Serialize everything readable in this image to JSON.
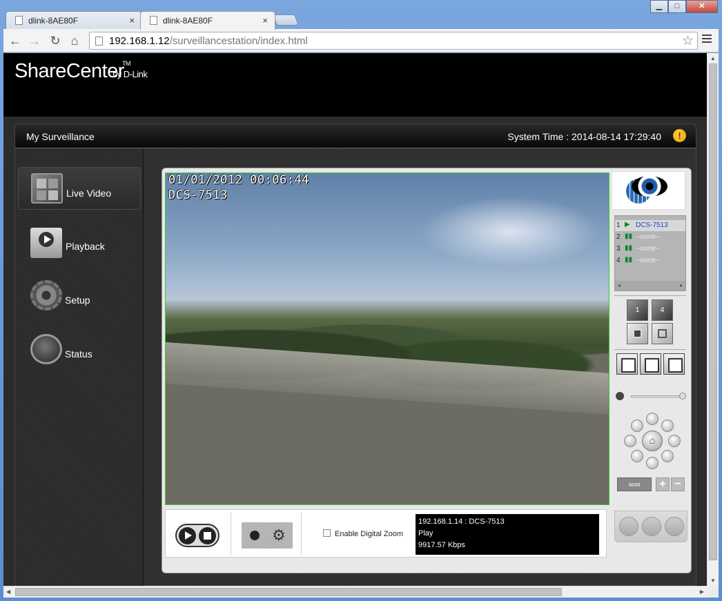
{
  "browser": {
    "tabs": [
      {
        "title": "dlink-8AE80F",
        "close": "×"
      },
      {
        "title": "dlink-8AE80F",
        "close": "×"
      }
    ],
    "url_host": "192.168.1.12",
    "url_path": "/surveillancestation/index.html",
    "window_buttons": {
      "minimize": "▁",
      "maximize": "□",
      "close": "✕"
    },
    "nav": {
      "back": "←",
      "forward": "→",
      "reload": "↻",
      "home": "⌂"
    },
    "star": "☆",
    "icons": [
      "page-icon",
      "star-icon",
      "menu-icon"
    ]
  },
  "app": {
    "logo": "ShareCenter",
    "logo_tm": "TM",
    "logo_sub": "by D-Link",
    "panel_title": "My Surveillance",
    "system_time": "System Time : 2014-08-14 17:29:40",
    "warning_glyph": "!"
  },
  "sidebar": {
    "items": [
      {
        "label": "Live Video",
        "icon": "live-video-icon",
        "active": true
      },
      {
        "label": "Playback",
        "icon": "playback-icon",
        "active": false
      },
      {
        "label": "Setup",
        "icon": "gear-icon",
        "active": false
      },
      {
        "label": "Status",
        "icon": "status-icon",
        "active": false
      }
    ]
  },
  "video": {
    "osd_datetime": "01/01/2012 00:06:44",
    "osd_camera": "DCS-7513"
  },
  "controls": {
    "digital_zoom_label": "Enable Digital Zoom",
    "digital_zoom_checked": false,
    "gear_glyph": "⚙"
  },
  "stream_info": {
    "source": "192.168.1.14 : DCS-7513",
    "status": "Play",
    "bitrate": "9917.57 Kbps"
  },
  "camera_list": [
    {
      "num": "1",
      "state_glyph": "▶",
      "name": "DCS-7513",
      "selected": true
    },
    {
      "num": "2",
      "state_glyph": "▮▮",
      "name": "--none--",
      "selected": false
    },
    {
      "num": "3",
      "state_glyph": "▮▮",
      "name": "--none--",
      "selected": false
    },
    {
      "num": "4",
      "state_glyph": "▮▮",
      "name": "--none--",
      "selected": false
    }
  ],
  "camera_list_scroll": {
    "left": "◂",
    "right": "▸"
  },
  "layouts": {
    "single": "1",
    "quad": "4"
  },
  "ptz": {
    "home_glyph": "⌂",
    "binoculars_glyph": "∞∞",
    "zoom_in": "+",
    "zoom_out": "−"
  },
  "volume": {
    "level": 0.95
  },
  "scrollbars": {
    "up": "▲",
    "down": "▼",
    "left": "◀",
    "right": "▶"
  }
}
